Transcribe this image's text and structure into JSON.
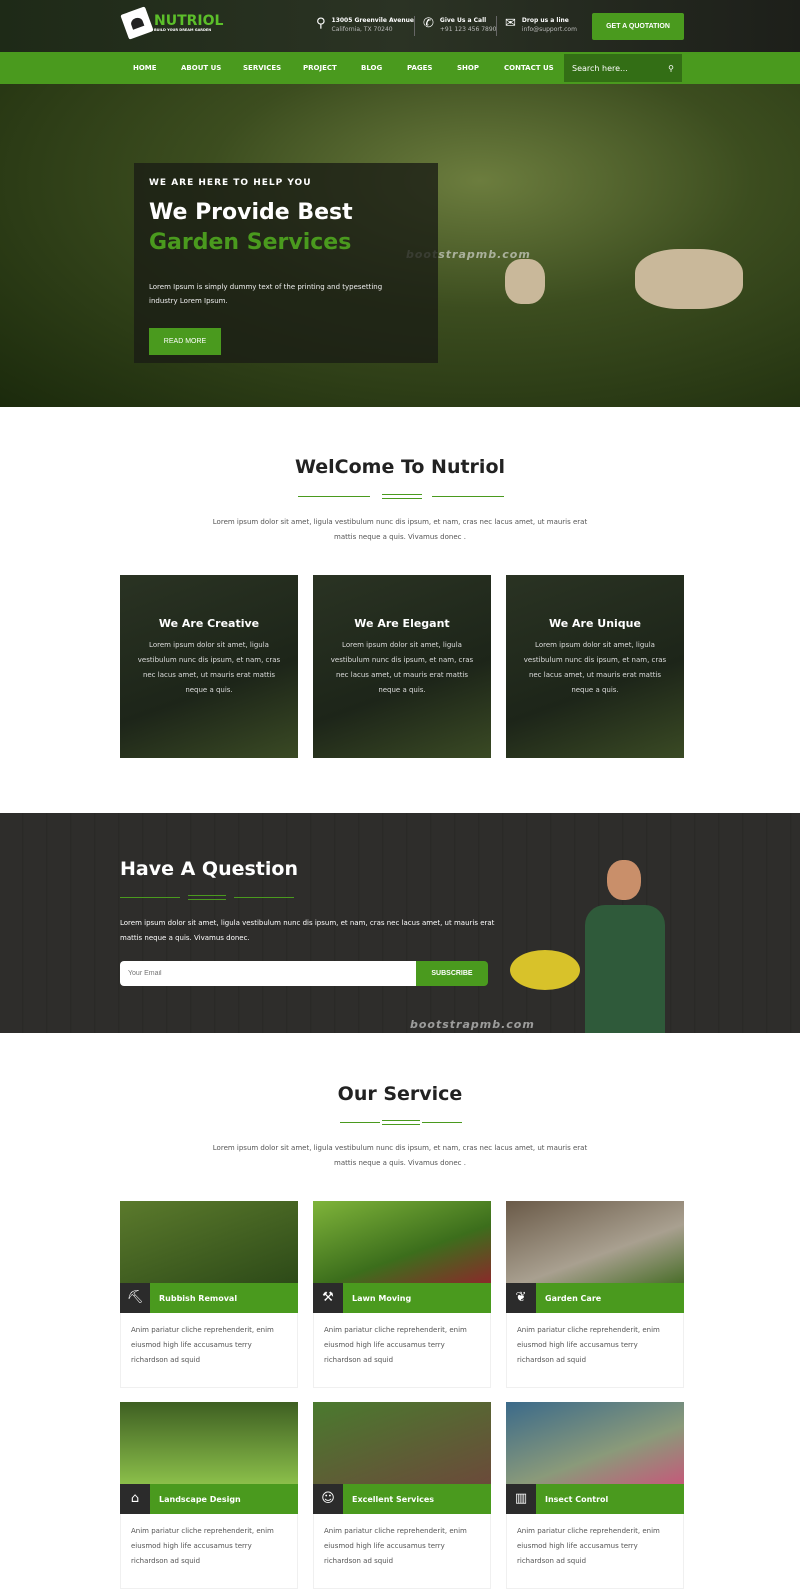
{
  "brand": {
    "name": "NUTRIOL",
    "tagline": "BUILD YOUR DREAM GARDEN"
  },
  "contact": [
    {
      "icon": "map-pin-icon",
      "title": "13005 Greenvile Avenue",
      "sub": "California, TX 70240"
    },
    {
      "icon": "phone-icon",
      "title": "Give Us a Call",
      "sub": "+91 123 456 7890"
    },
    {
      "icon": "envelope-icon",
      "title": "Drop us a line",
      "sub": "info@support.com"
    }
  ],
  "quote_button": "GET A QUOTATION",
  "nav": [
    "HOME",
    "ABOUT US",
    "SERVICES",
    "PROJECT",
    "BLOG",
    "PAGES",
    "SHOP",
    "CONTACT US"
  ],
  "search": {
    "placeholder": "Search here..."
  },
  "hero": {
    "kicker": "WE ARE HERE TO HELP YOU",
    "title1": "We Provide Best",
    "title2": "Garden Services",
    "text": "Lorem Ipsum is simply dummy text of the printing and typesetting industry Lorem Ipsum.",
    "button": "READ MORE",
    "watermark": "bootstrapmb.com"
  },
  "welcome": {
    "title": "WelCome To Nutriol",
    "text": "Lorem ipsum dolor sit amet, ligula vestibulum nunc dis ipsum, et nam, cras nec lacus amet, ut mauris erat mattis neque a quis. Vivamus donec ."
  },
  "features": [
    {
      "title": "We Are Creative",
      "text": "Lorem ipsum dolor sit amet, ligula vestibulum nunc dis ipsum, et nam, cras nec lacus amet, ut mauris erat mattis neque a quis."
    },
    {
      "title": "We Are Elegant",
      "text": "Lorem ipsum dolor sit amet, ligula vestibulum nunc dis ipsum, et nam, cras nec lacus amet, ut mauris erat mattis neque a quis."
    },
    {
      "title": "We Are Unique",
      "text": "Lorem ipsum dolor sit amet, ligula vestibulum nunc dis ipsum, et nam, cras nec lacus amet, ut mauris erat mattis neque a quis."
    }
  ],
  "question": {
    "title": "Have A Question",
    "text": "Lorem ipsum dolor sit amet, ligula vestibulum nunc dis ipsum, et nam, cras nec lacus amet, ut mauris erat mattis neque a quis. Vivamus donec.",
    "email_placeholder": "Your Email",
    "button": "SUBSCRIBE",
    "watermark": "bootstrapmb.com"
  },
  "services": {
    "title": "Our Service",
    "text": "Lorem ipsum dolor sit amet, ligula vestibulum nunc dis ipsum, et nam, cras nec lacus amet, ut mauris erat mattis neque a quis. Vivamus donec .",
    "items": [
      {
        "name": "Rubbish Removal",
        "icon": "shovel-icon",
        "text": "Anim pariatur cliche reprehenderit, enim eiusmod high life accusamus terry richardson ad squid"
      },
      {
        "name": "Lawn Moving",
        "icon": "gardener-icon",
        "text": "Anim pariatur cliche reprehenderit, enim eiusmod high life accusamus terry richardson ad squid"
      },
      {
        "name": "Garden Care",
        "icon": "plant-hand-icon",
        "text": "Anim pariatur cliche reprehenderit, enim eiusmod high life accusamus terry richardson ad squid"
      },
      {
        "name": "Landscape Design",
        "icon": "house-plant-icon",
        "text": "Anim pariatur cliche reprehenderit, enim eiusmod high life accusamus terry richardson ad squid"
      },
      {
        "name": "Excellent Services",
        "icon": "worker-icon",
        "text": "Anim pariatur cliche reprehenderit, enim eiusmod high life accusamus terry richardson ad squid"
      },
      {
        "name": "Insect Control",
        "icon": "fence-icon",
        "text": "Anim pariatur cliche reprehenderit, enim eiusmod high life accusamus terry richardson ad squid"
      }
    ]
  },
  "colors": {
    "accent": "#4a9a1e",
    "dark": "#2b2b2b"
  }
}
